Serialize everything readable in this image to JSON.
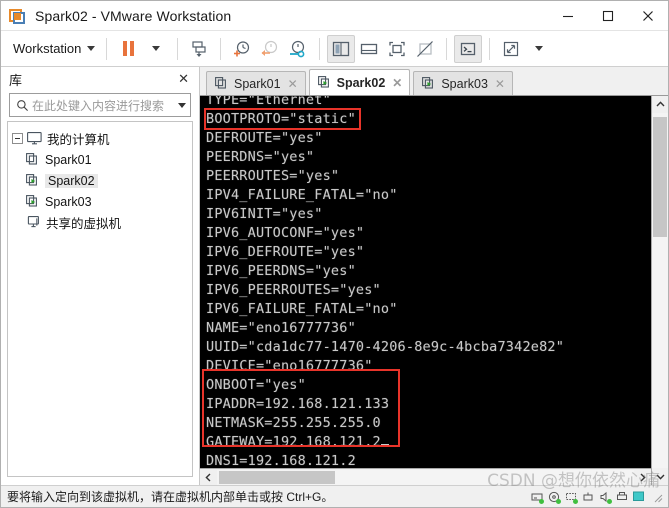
{
  "window": {
    "title": "Spark02 - VMware Workstation",
    "logo_icon": "vmware-logo-icon",
    "minimize_label": "─",
    "maximize_label": "□",
    "close_label": "✕"
  },
  "toolbar": {
    "workstation_menu": "Workstation",
    "items": [
      {
        "name": "pause-button",
        "icon": "pause-icon"
      },
      {
        "name": "pause-dropdown",
        "icon": "chevron-down-icon"
      },
      {
        "name": "send-ctrl-alt-del-button",
        "icon": "send-key-icon"
      },
      {
        "name": "take-snapshot-button",
        "icon": "snapshot-add-icon"
      },
      {
        "name": "revert-snapshot-button",
        "icon": "snapshot-revert-icon"
      },
      {
        "name": "snapshot-manager-button",
        "icon": "snapshot-manager-icon"
      },
      {
        "name": "show-library-button",
        "icon": "library-panel-icon"
      },
      {
        "name": "show-console-view-button",
        "icon": "console-view-icon"
      },
      {
        "name": "enter-fullscreen-button",
        "icon": "fullscreen-icon"
      },
      {
        "name": "unity-mode-button",
        "icon": "unity-mode-disabled-icon"
      },
      {
        "name": "cli-button",
        "icon": "terminal-prompt-icon"
      },
      {
        "name": "stretch-button",
        "icon": "expand-arrows-icon"
      },
      {
        "name": "stretch-dropdown",
        "icon": "chevron-down-icon"
      }
    ]
  },
  "sidebar": {
    "title": "库",
    "close_label": "✕",
    "search": {
      "placeholder": "在此处键入内容进行搜索",
      "value": "",
      "icon": "search-icon",
      "dropdown_icon": "chevron-down-icon"
    },
    "tree": [
      {
        "label": "我的计算机",
        "icon": "computer-icon",
        "level": 0,
        "expanded": true,
        "selected": false
      },
      {
        "label": "Spark01",
        "icon": "vm-stopped-icon",
        "level": 1,
        "expanded": false,
        "selected": false
      },
      {
        "label": "Spark02",
        "icon": "vm-running-icon",
        "level": 1,
        "expanded": false,
        "selected": true
      },
      {
        "label": "Spark03",
        "icon": "vm-running-icon",
        "level": 1,
        "expanded": false,
        "selected": false
      },
      {
        "label": "共享的虚拟机",
        "icon": "shared-vms-icon",
        "level": 0,
        "expanded": false,
        "selected": false
      }
    ]
  },
  "tabs": [
    {
      "label": "Spark01",
      "icon": "vm-stopped-icon",
      "active": false,
      "close_label": "✕"
    },
    {
      "label": "Spark02",
      "icon": "vm-running-icon",
      "active": true,
      "close_label": "✕"
    },
    {
      "label": "Spark03",
      "icon": "vm-running-icon",
      "active": false,
      "close_label": "✕"
    }
  ],
  "terminal": {
    "lines": [
      "TYPE=\"Ethernet\"",
      "BOOTPROTO=\"static\"",
      "DEFROUTE=\"yes\"",
      "PEERDNS=\"yes\"",
      "PEERROUTES=\"yes\"",
      "IPV4_FAILURE_FATAL=\"no\"",
      "IPV6INIT=\"yes\"",
      "IPV6_AUTOCONF=\"yes\"",
      "IPV6_DEFROUTE=\"yes\"",
      "IPV6_PEERDNS=\"yes\"",
      "IPV6_PEERROUTES=\"yes\"",
      "IPV6_FAILURE_FATAL=\"no\"",
      "NAME=\"eno16777736\"",
      "UUID=\"cda1dc77-1470-4206-8e9c-4bcba7342e82\"",
      "DEVICE=\"eno16777736\"",
      "ONBOOT=\"yes\"",
      "",
      "IPADDR=192.168.121.133",
      "NETMASK=255.255.255.0",
      "GATEWAY=192.168.121.2",
      "DNS1=192.168.121.2"
    ],
    "cursor_line_index": 19,
    "highlight_color": "#e8342a",
    "foreground_color": "#c9c9c9",
    "background_color": "#000000"
  },
  "scrollbars": {
    "vertical": {
      "up_icon": "chevron-up-icon",
      "down_icon": "chevron-down-icon"
    },
    "horizontal": {
      "left_icon": "chevron-left-icon",
      "right_icon": "chevron-right-icon"
    }
  },
  "statusbar": {
    "message": "要将输入定向到该虚拟机，请在虚拟机内部单击或按 Ctrl+G。",
    "tray_icons": [
      {
        "name": "hard-disk-status-icon"
      },
      {
        "name": "cd-dvd-status-icon"
      },
      {
        "name": "network-status-icon"
      },
      {
        "name": "usb-status-icon"
      },
      {
        "name": "sound-status-icon"
      },
      {
        "name": "printer-status-icon"
      },
      {
        "name": "display-status-icon"
      }
    ]
  },
  "watermark": {
    "text": "CSDN @想你依然心痛"
  }
}
